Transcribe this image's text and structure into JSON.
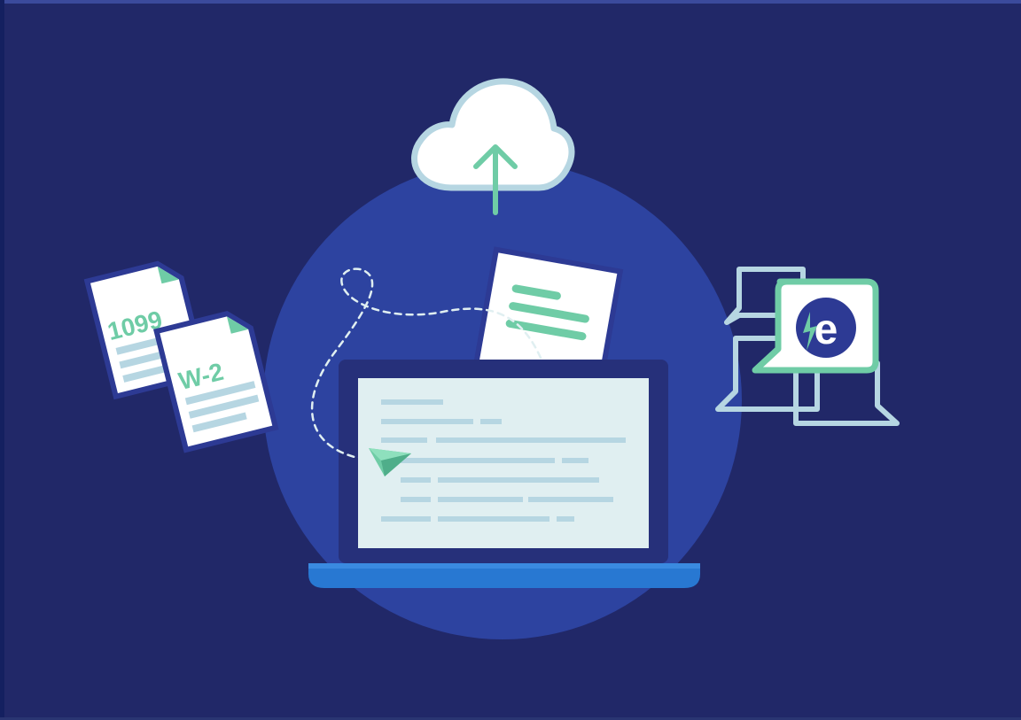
{
  "illustration": {
    "form_1099_label": "1099",
    "form_w2_label": "W-2",
    "brand_letter": "e"
  },
  "colors": {
    "background": "#212868",
    "circle": "#2d43a0",
    "accent_green": "#6fcca6",
    "screen": "#e0eff1",
    "line_blue": "#b6d6e2",
    "laptop_base": "#2878d2"
  },
  "icons": [
    "cloud-upload-icon",
    "tax-form-1099-icon",
    "tax-form-w2-icon",
    "document-icon",
    "laptop-icon",
    "chat-bubbles-icon",
    "brand-logo-icon",
    "paper-plane-icon"
  ]
}
